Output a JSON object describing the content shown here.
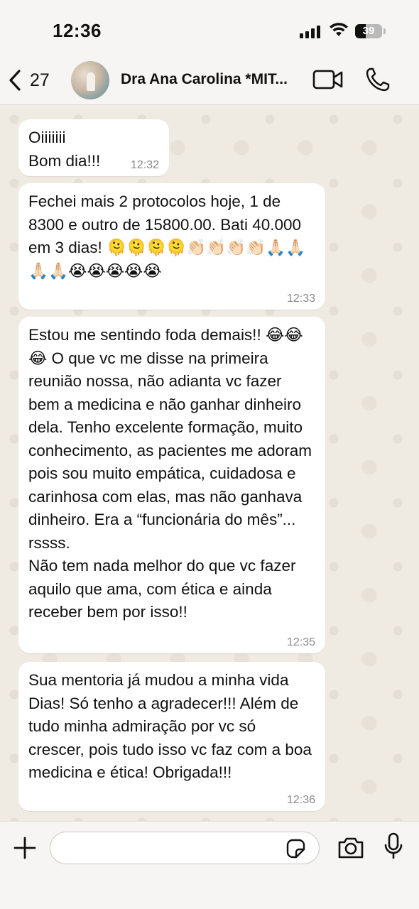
{
  "status_bar": {
    "time": "12:36",
    "battery": "39",
    "battery_level": 0.39,
    "icons": [
      "signal-icon",
      "wifi-icon",
      "battery-icon"
    ]
  },
  "header": {
    "back_count": "27",
    "contact_name": "Dra Ana Carolina *MIT...",
    "icons": [
      "chevron-left-icon",
      "video-call-icon",
      "phone-icon"
    ]
  },
  "messages": [
    {
      "text": "Oiiiiiii\nBom dia!!!",
      "time": "12:32"
    },
    {
      "text": "Fechei mais 2 protocolos hoje, 1 de 8300 e outro de 15800.00. Bati 40.000 em 3 dias! 🫠🫠🫠🫠👏🏻👏🏻👏🏻👏🏻🙏🏻🙏🏻🙏🏻🙏🏻😭😭😭😭😭",
      "time": "12:33"
    },
    {
      "text": "Estou me sentindo foda demais!! 😂😂😂 O que vc me disse na primeira reunião nossa, não adianta vc fazer bem a medicina e não ganhar dinheiro dela. Tenho excelente formação, muito conhecimento, as pacientes me adoram pois sou muito empática, cuidadosa e carinhosa com elas, mas não ganhava dinheiro. Era a “funcionária do mês”... rssss.\nNão tem nada melhor do que vc fazer aquilo que ama, com ética e ainda receber bem por isso!!",
      "time": "12:35"
    },
    {
      "text": "Sua mentoria já mudou a minha vida Dias! Só tenho a agradecer!!! Além de tudo minha admiração por vc só crescer, pois tudo isso vc faz com a boa medicina e ética! Obrigada!!!",
      "time": "12:36"
    }
  ],
  "input_bar": {
    "placeholder": "",
    "icons": [
      "plus-icon",
      "sticker-icon",
      "camera-icon",
      "microphone-icon"
    ]
  }
}
